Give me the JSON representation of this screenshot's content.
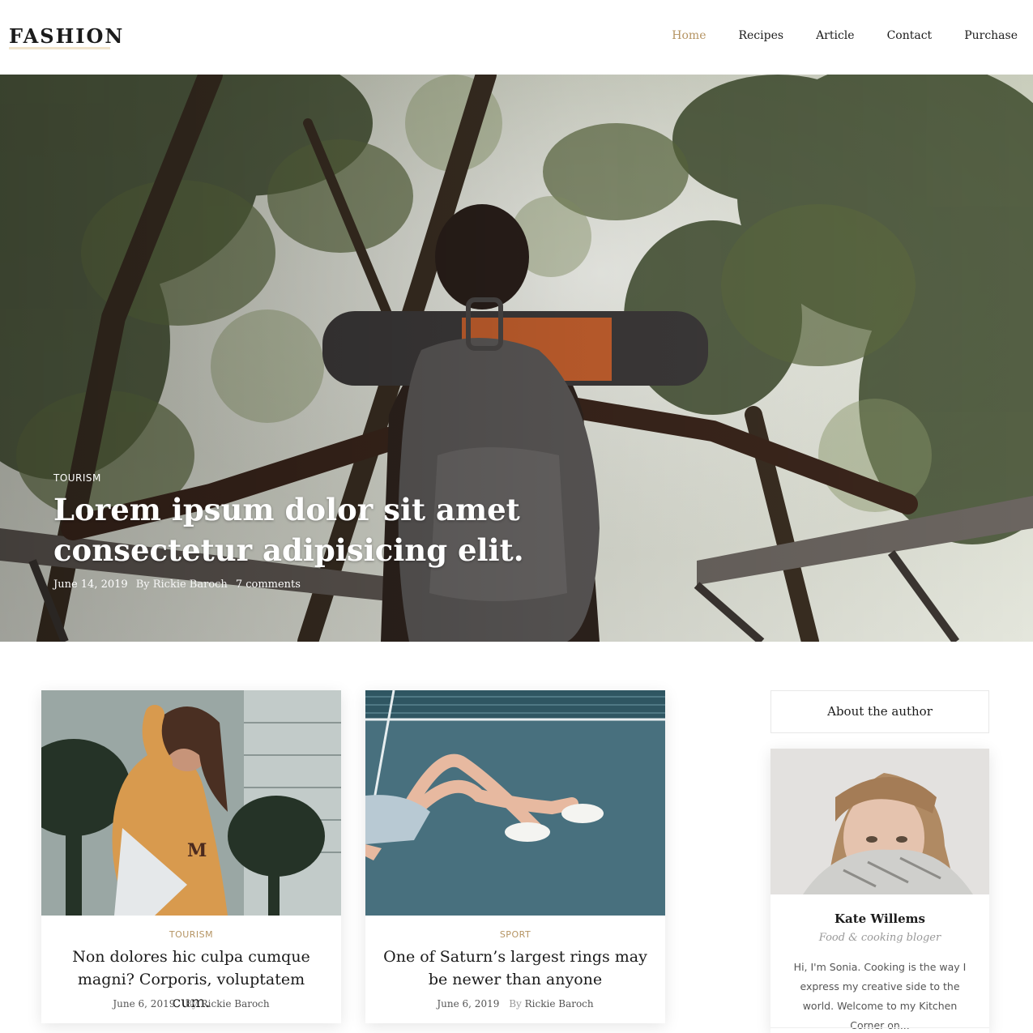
{
  "header": {
    "logo": "FASHION",
    "nav": [
      {
        "label": "Home",
        "active": true
      },
      {
        "label": "Recipes",
        "active": false
      },
      {
        "label": "Article",
        "active": false
      },
      {
        "label": "Contact",
        "active": false
      },
      {
        "label": "Purchase",
        "active": false
      }
    ]
  },
  "hero": {
    "category": "TOURISM",
    "title": "Lorem ipsum dolor sit amet consectetur adipisicing elit.",
    "date": "June 14, 2019",
    "author": "By Rickie Baroch",
    "comments": "7 comments"
  },
  "posts": [
    {
      "category": "TOURISM",
      "title": "Non dolores hic culpa cumque magni? Corporis, voluptatem cum.",
      "date": "June 6, 2019",
      "by_label": "By",
      "author": "Rickie Baroch"
    },
    {
      "category": "SPORT",
      "title": "One of Saturn’s largest rings may be newer than anyone",
      "date": "June 6, 2019",
      "by_label": "By",
      "author": "Rickie Baroch"
    }
  ],
  "sidebar": {
    "about_title": "About the author",
    "author_name": "Kate Willems",
    "author_role": "Food & cooking bloger",
    "author_bio": "Hi, I'm Sonia. Cooking is the way I express my creative side to the world. Welcome to my Kitchen Corner on..."
  },
  "colors": {
    "accent": "#b59463",
    "text": "#1b1b1b",
    "muted": "#999999"
  }
}
